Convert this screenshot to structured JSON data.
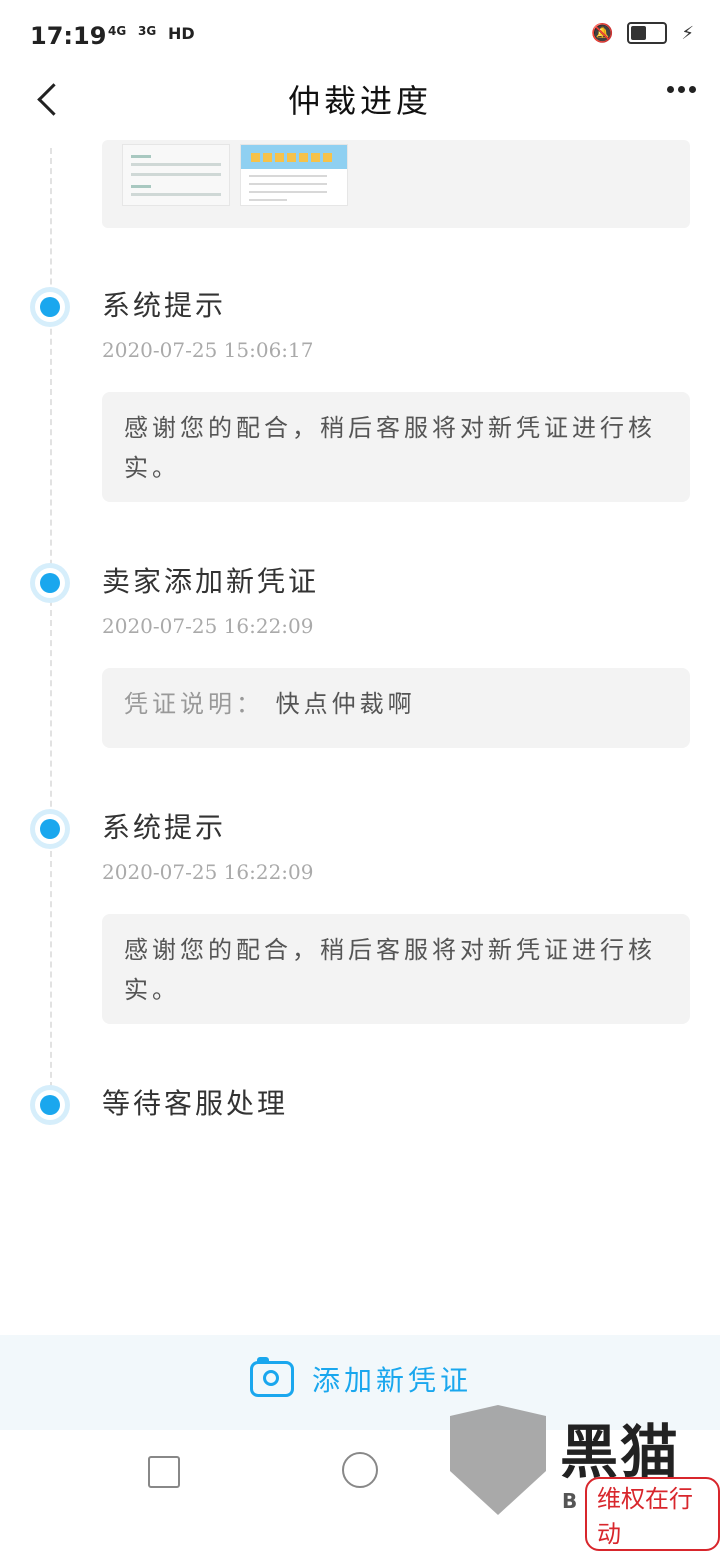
{
  "status_bar": {
    "time": "17:19",
    "signal1": "4G",
    "signal2": "3G",
    "hd": "HD"
  },
  "header": {
    "title": "仲裁进度"
  },
  "events": [
    {
      "title": "系统提示",
      "time": "2020-07-25 15:06:17",
      "message": "感谢您的配合，稍后客服将对新凭证进行核实。"
    },
    {
      "title": "卖家添加新凭证",
      "time": "2020-07-25 16:22:09",
      "message_label": "凭证说明：",
      "message_value": "快点仲裁啊"
    },
    {
      "title": "系统提示",
      "time": "2020-07-25 16:22:09",
      "message": "感谢您的配合，稍后客服将对新凭证进行核实。"
    },
    {
      "title": "等待客服处理"
    }
  ],
  "bottom": {
    "add_evidence_label": "添加新凭证"
  },
  "watermark": {
    "name": "黑猫",
    "sub": "维权在行动",
    "b": "B"
  },
  "colors": {
    "accent": "#1aa7ee",
    "card_bg": "#f3f3f3"
  }
}
